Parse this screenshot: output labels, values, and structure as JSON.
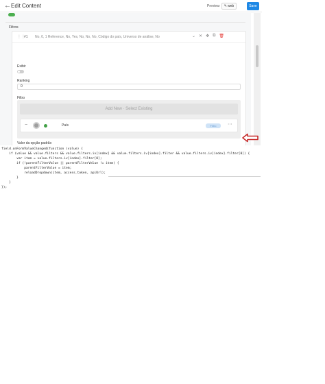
{
  "header": {
    "title": "Edit Content",
    "preview_label": "Preview:",
    "web_button": "web",
    "save_button": "Save"
  },
  "filtros_section": {
    "heading": "Filtros"
  },
  "filter_item": {
    "index": "#1",
    "summary": "No, 0, 1 Reference, No, Yes, No, No, No, Código do país, Universo de análise, No",
    "fields": {
      "exibir_label": "Exibir",
      "ranking_label": "Ranking",
      "ranking_value": "0",
      "filtro_label": "Filtro",
      "default_option_label": "Valor da opção padrão"
    },
    "filtro_box": {
      "add_new": "Add New · Select Existing",
      "row": {
        "title": "País",
        "badge": "Filtro"
      }
    }
  },
  "icons": {
    "back": "arrow-left-icon",
    "drag": "drag-handle-icon",
    "header_actions": [
      "chevron-down-icon",
      "close-icon",
      "move-icon",
      "copy-icon",
      "delete-icon"
    ],
    "row": [
      "minus-icon",
      "avatar-icon",
      "status-dot-icon",
      "more-icon"
    ],
    "select": "chevron-down-icon",
    "annotation": "red-arrow-icon"
  },
  "colors": {
    "accent": "#1e88e5",
    "toggle_on": "#4caf50",
    "status_green": "#43a047",
    "delete_red": "#e53935",
    "annotation_red": "#c62828",
    "badge_bg": "#cfe3f7"
  },
  "code": {
    "lines": [
      "field.onFormValueChanged(function (value) {",
      "    if (value && value.filters && value.filters.iv[index] && value.filters.iv[index].filter && value.filters.iv[index].filter[0]) {",
      "        var item = value.filters.iv[index].filter[0];",
      "        if (!parentFilterValue || parentFilterValue != item) {",
      "            parentFilterValue = item;",
      "            reloadDropdown(item, access_token, apiUrl);",
      "        }",
      "    }",
      "});"
    ]
  }
}
